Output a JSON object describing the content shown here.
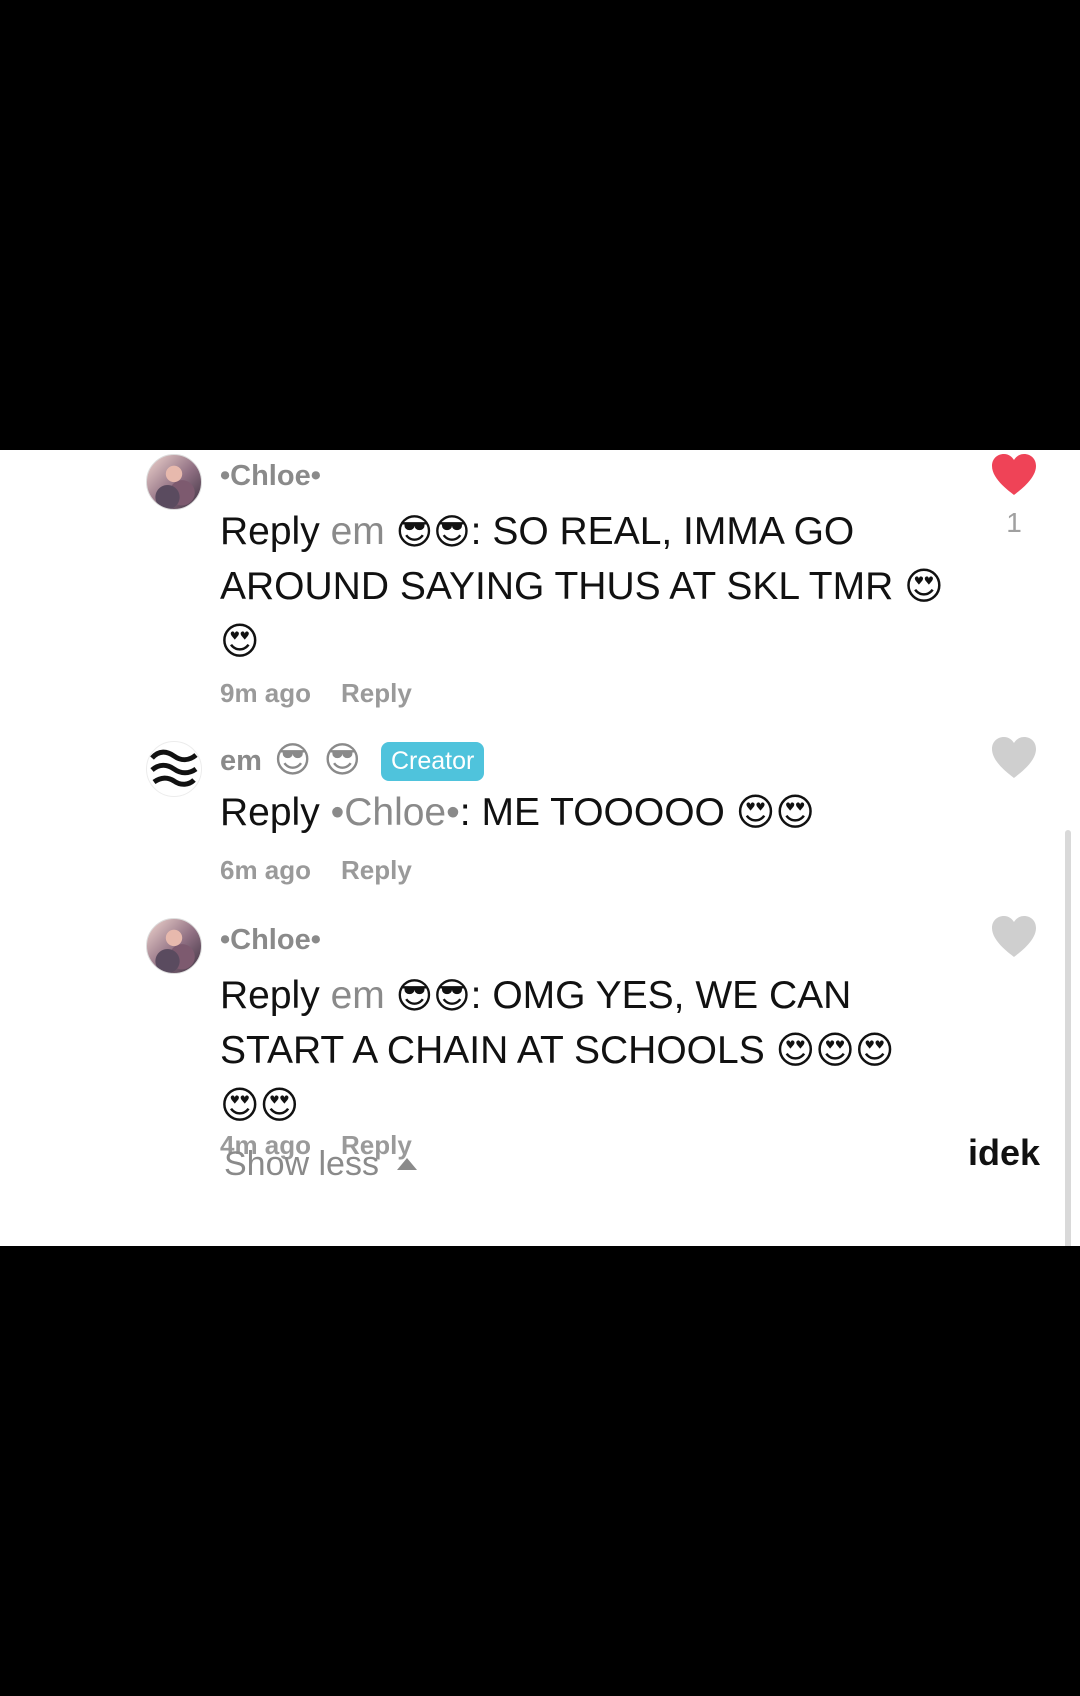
{
  "comments": [
    {
      "username": "•Chloe•",
      "reply_prefix": "Reply",
      "reply_to": "em",
      "reply_to_emojis": [
        "😎",
        "😎"
      ],
      "text": ": SO REAL, IMMA GO AROUND SAYING THUS AT SKL TMR",
      "trailing_emojis": [
        "😍",
        "😍"
      ],
      "time": "9m ago",
      "reply_label": "Reply",
      "like_state": "liked",
      "like_count": "1",
      "avatar": "profile-photo"
    },
    {
      "username": "em",
      "username_emojis": [
        "😎",
        "😎"
      ],
      "badge": "Creator",
      "reply_prefix": "Reply",
      "reply_to": "•Chloe•",
      "text": ": ME TOOOOO",
      "trailing_emojis": [
        "😍",
        "😍"
      ],
      "time": "6m ago",
      "reply_label": "Reply",
      "like_state": "not-liked",
      "avatar": "mentally unstable"
    },
    {
      "username": "•Chloe•",
      "reply_prefix": "Reply",
      "reply_to": "em",
      "reply_to_emojis": [
        "😎",
        "😎"
      ],
      "text": ": OMG YES, WE CAN START A CHAIN AT SCHOOLS",
      "trailing_emojis": [
        "😍",
        "😍",
        "😍",
        "😍",
        "😍"
      ],
      "time": "4m ago",
      "reply_label": "Reply",
      "like_state": "not-liked",
      "avatar": "profile-photo"
    }
  ],
  "show_less_label": "Show less",
  "watermark": "idek",
  "colors": {
    "liked_heart": "#ef4357",
    "unliked_heart": "#cfcfcf",
    "creator_badge": "#4fc3dc",
    "muted_text": "#8a8a8a"
  },
  "icons": {
    "like": "heart-icon",
    "show_less": "triangle-up-icon"
  }
}
